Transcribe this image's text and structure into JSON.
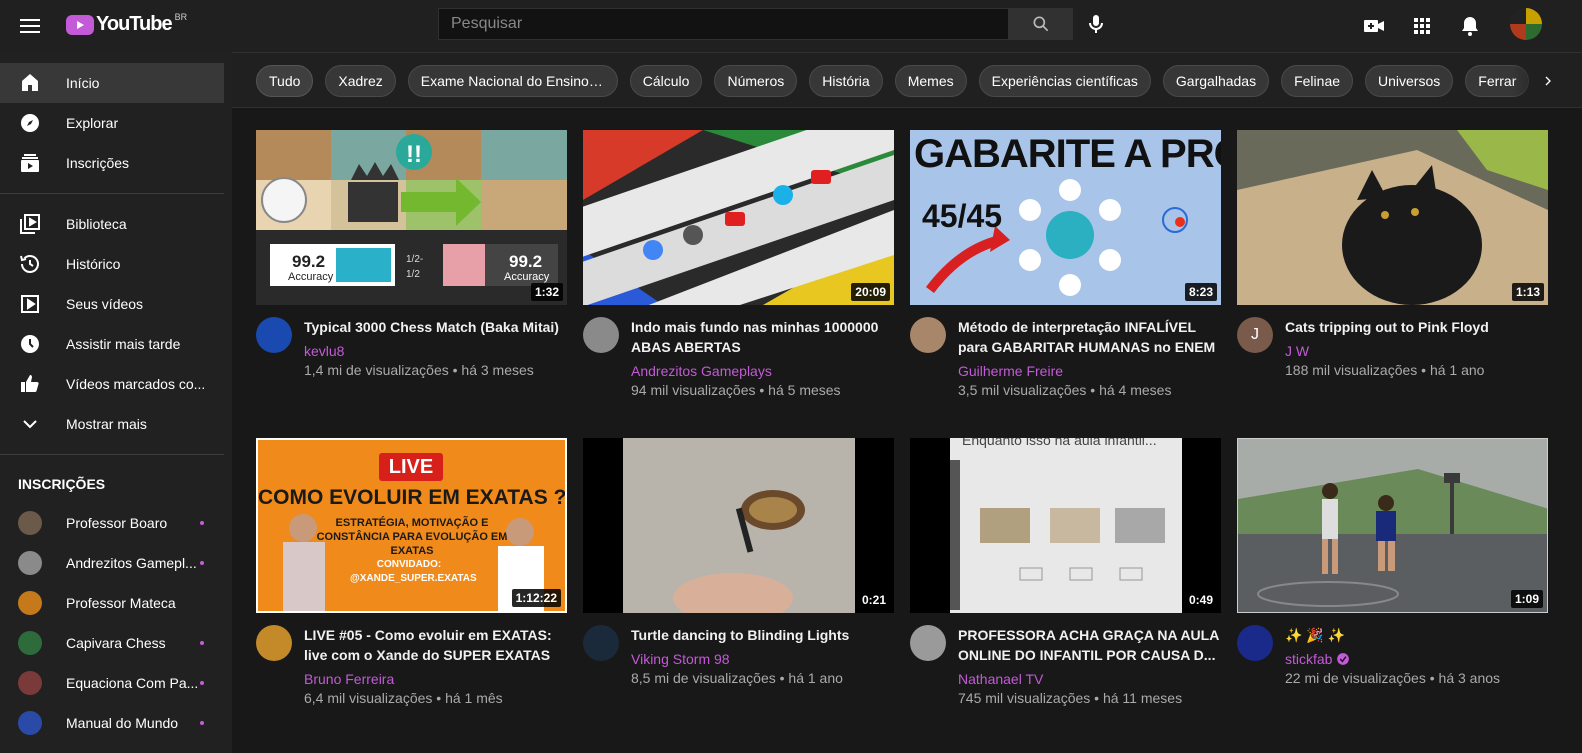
{
  "header": {
    "logo_text": "YouTube",
    "country_code": "BR",
    "search_placeholder": "Pesquisar",
    "icons": [
      "menu-icon",
      "search-icon",
      "mic-icon",
      "create-video-icon",
      "apps-icon",
      "notifications-icon"
    ]
  },
  "sidebar": {
    "main_items": [
      {
        "label": "Início",
        "icon": "home-icon",
        "active": true
      },
      {
        "label": "Explorar",
        "icon": "compass-icon"
      },
      {
        "label": "Inscrições",
        "icon": "subscriptions-icon"
      }
    ],
    "library_items": [
      {
        "label": "Biblioteca",
        "icon": "library-icon"
      },
      {
        "label": "Histórico",
        "icon": "history-icon"
      },
      {
        "label": "Seus vídeos",
        "icon": "your-videos-icon"
      },
      {
        "label": "Assistir mais tarde",
        "icon": "watch-later-icon"
      },
      {
        "label": "Vídeos marcados co...",
        "icon": "thumbs-up-icon"
      },
      {
        "label": "Mostrar mais",
        "icon": "chevron-down-icon"
      }
    ],
    "subscriptions_title": "INSCRIÇÕES",
    "subscriptions": [
      {
        "name": "Professor Boaro",
        "color": "#6b5a4a"
      },
      {
        "name": "Andrezitos Gamepl...",
        "color": "#8a8a8a"
      },
      {
        "name": "Professor Mateca",
        "color": "#c47a1a"
      },
      {
        "name": "Capivara Chess",
        "color": "#2e6b3a"
      },
      {
        "name": "Equaciona Com Pa...",
        "color": "#7a3a3a"
      },
      {
        "name": "Manual do Mundo",
        "color": "#2a4aa8"
      }
    ]
  },
  "chips": [
    "Tudo",
    "Xadrez",
    "Exame Nacional do Ensino Mé...",
    "Cálculo",
    "Números",
    "História",
    "Memes",
    "Experiências científicas",
    "Gargalhadas",
    "Felinae",
    "Universos",
    "Ferrar"
  ],
  "videos": [
    {
      "title": "Typical 3000 Chess Match (Baka Mitai)",
      "channel": "kevlu8",
      "stats": "1,4 mi de visualizações • há 3 meses",
      "duration": "1:32",
      "avatar_color": "#1a4ab0",
      "avatar_letter": ""
    },
    {
      "title": "Indo mais fundo nas minhas 1000000 ABAS ABERTAS",
      "channel": "Andrezitos Gameplays",
      "stats": "94 mil visualizações • há 5 meses",
      "duration": "20:09",
      "avatar_color": "#8a8a8a",
      "avatar_letter": ""
    },
    {
      "title": "Método de interpretação INFALÍVEL para GABARITAR HUMANAS no ENEM",
      "channel": "Guilherme Freire",
      "stats": "3,5 mil visualizações • há 4 meses",
      "duration": "8:23",
      "avatar_color": "#a8866a",
      "avatar_letter": ""
    },
    {
      "title": "Cats tripping out to Pink Floyd",
      "channel": "J W",
      "stats": "188 mil visualizações • há 1 ano",
      "duration": "1:13",
      "avatar_color": "#7a5a4a",
      "avatar_letter": "J"
    },
    {
      "title": "LIVE #05 - Como evoluir em EXATAS: live com o Xande do SUPER EXATAS",
      "channel": "Bruno Ferreira",
      "stats": "6,4 mil visualizações • há 1 mês",
      "duration": "1:12:22",
      "avatar_color": "#c48a2a",
      "avatar_letter": ""
    },
    {
      "title": "Turtle dancing to Blinding Lights",
      "channel": "Viking Storm 98",
      "stats": "8,5 mi de visualizações • há 1 ano",
      "duration": "0:21",
      "avatar_color": "#1a2a3a",
      "avatar_letter": ""
    },
    {
      "title": "PROFESSORA ACHA GRAÇA NA AULA ONLINE DO INFANTIL POR CAUSA D...",
      "channel": "Nathanael TV",
      "stats": "745 mil visualizações • há 11 meses",
      "duration": "0:49",
      "avatar_color": "#9a9a9a",
      "avatar_letter": ""
    },
    {
      "title": "✨ 🎉 ✨",
      "channel": "stickfab",
      "stats": "22 mi de visualizações • há 3 anos",
      "duration": "1:09",
      "avatar_color": "#1a2a8a",
      "avatar_letter": "",
      "verified": true
    }
  ],
  "thumb_text": {
    "chess_score": "99.2",
    "chess_accuracy": "Accuracy",
    "chess_result": "1/2-1/2",
    "gabarite_title": "GABARITE A PROVA!!",
    "gabarite_score": "45/45",
    "live_badge": "LIVE",
    "live_title": "COMO EVOLUIR EM EXATAS ?",
    "live_sub": "ESTRATÉGIA, MOTIVAÇÃO E CONSTÂNCIA PARA EVOLUÇÃO EM EXATAS",
    "live_guest": "CONVIDADO: @XANDE_SUPER.EXATAS",
    "infantil_caption": "Enquanto isso na aula infantil..."
  },
  "accent": "#c35ad7"
}
